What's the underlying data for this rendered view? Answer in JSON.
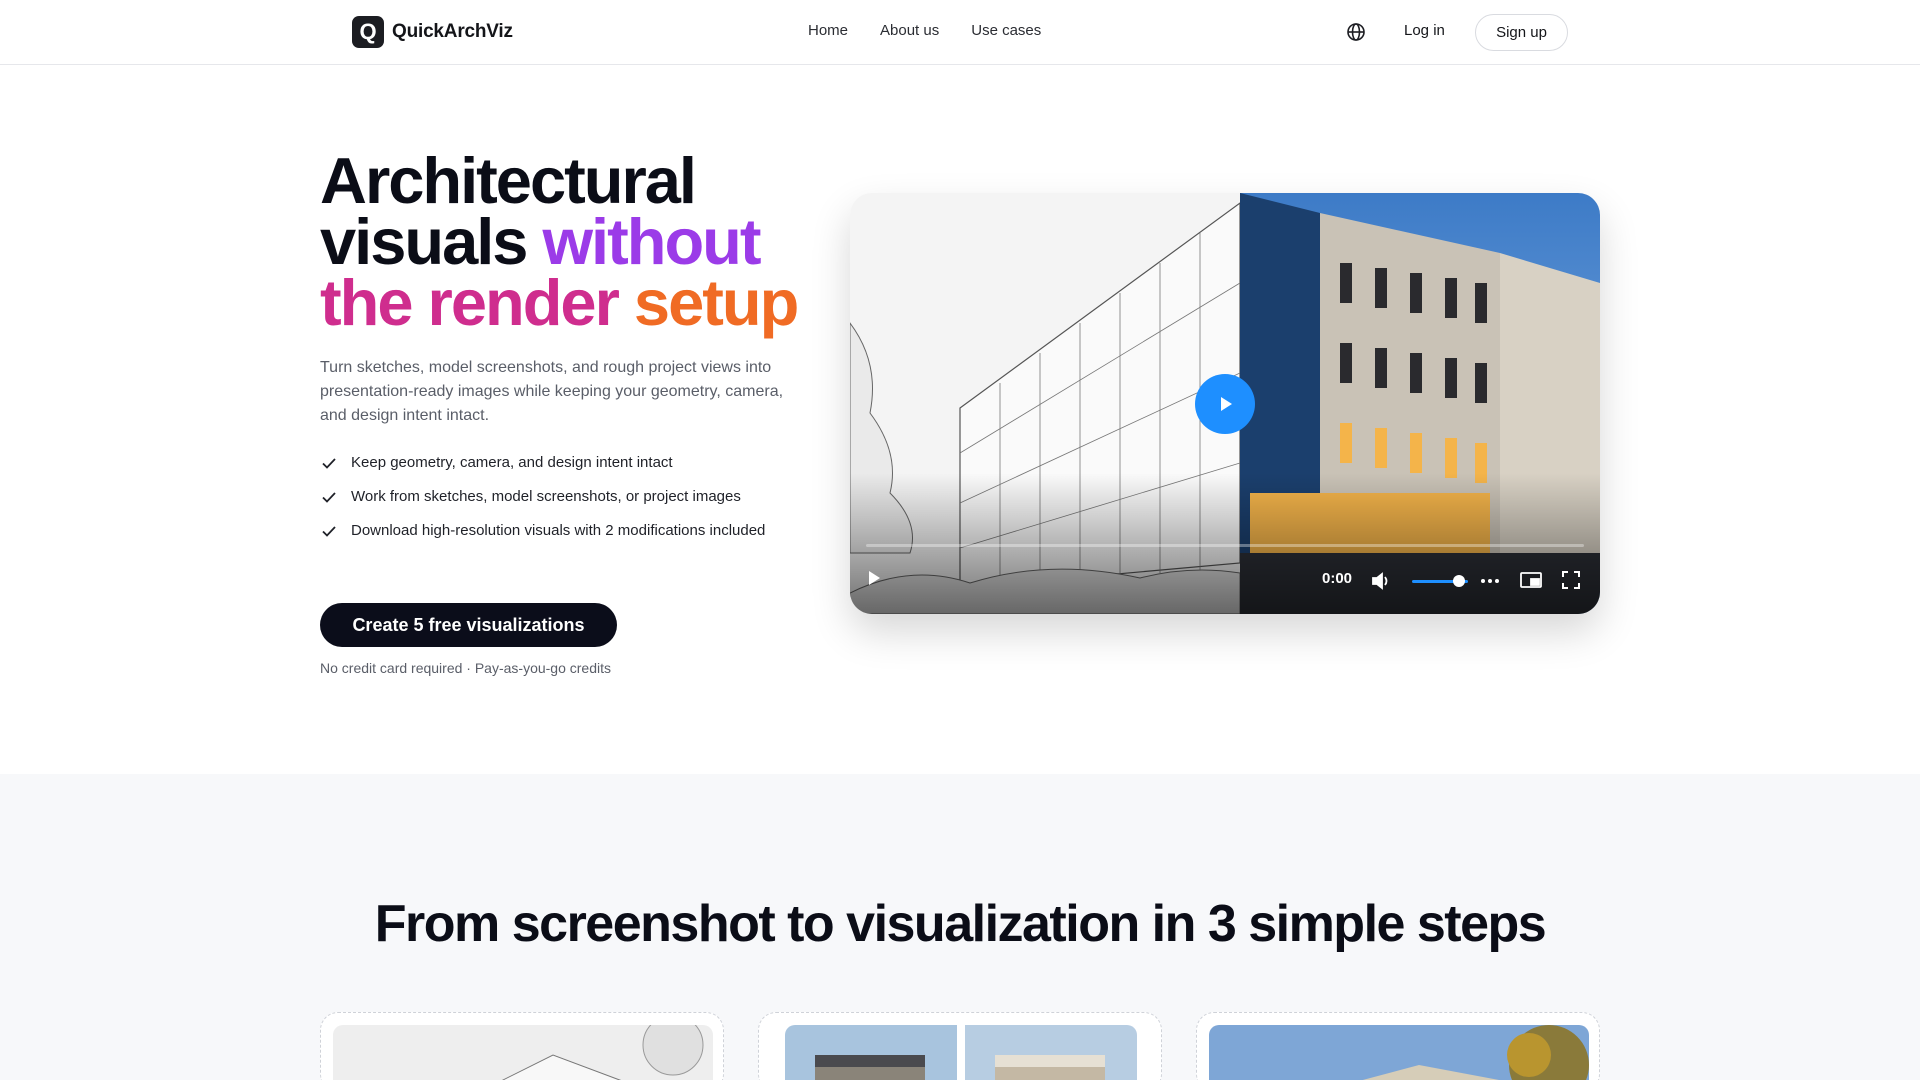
{
  "brand": {
    "logo_letter": "Q",
    "name": "QuickArchViz"
  },
  "nav": {
    "links": [
      "Home",
      "About us",
      "Use cases"
    ],
    "language_icon": "globe-icon",
    "login": "Log in",
    "signup": "Sign up"
  },
  "hero": {
    "title": {
      "line1": "Architectural",
      "line2_a": "visuals ",
      "line2_b": "without",
      "line3_a": "the render ",
      "line3_b": "setup"
    },
    "subtitle": "Turn sketches, model screenshots, and rough project views into presentation-ready images while keeping your geometry, camera, and design intent intact.",
    "checklist": [
      "Keep geometry, camera, and design intent intact",
      "Work from sketches, model screenshots, or project images",
      "Download high-resolution visuals with 2 modifications included"
    ],
    "cta": "Create 5 free visualizations",
    "cta_note": "No credit card required · Pay-as-you-go credits"
  },
  "video": {
    "time": "0:00",
    "volume": 0.8,
    "icons": [
      "play-icon",
      "volume-icon",
      "more-icon",
      "picture-in-picture-icon",
      "fullscreen-icon"
    ]
  },
  "steps": {
    "title": "From screenshot to visualization in 3 simple steps"
  },
  "colors": {
    "accent_purple": "#9b3be8",
    "accent_magenta": "#cf2d8e",
    "accent_orange": "#f06b24",
    "play_blue": "#1e8fff",
    "cta_bg": "#0b0d1a"
  }
}
